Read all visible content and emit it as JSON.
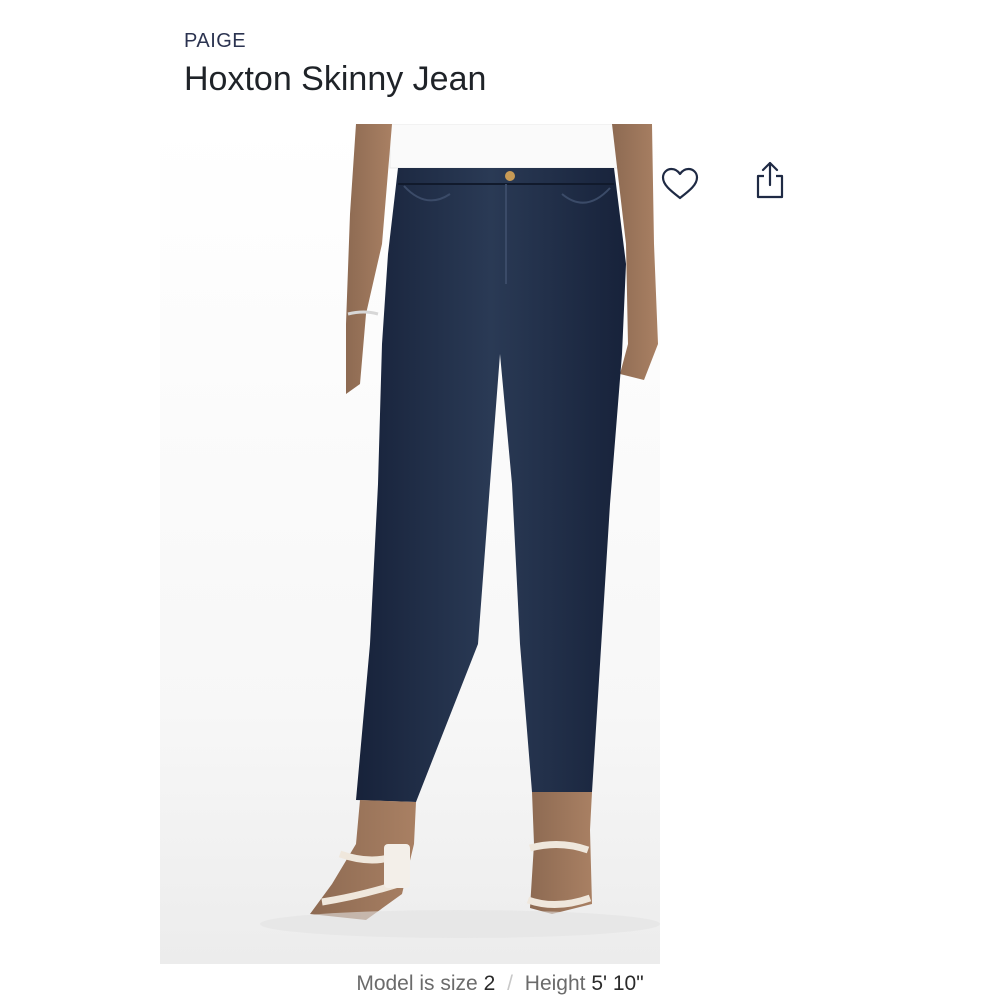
{
  "product": {
    "brand": "PAIGE",
    "title": "Hoxton Skinny Jean"
  },
  "actions": {
    "favorite_icon": "heart-icon",
    "share_icon": "share-icon"
  },
  "model_info": {
    "size_label": "Model is size",
    "size_value": "2",
    "separator": "/",
    "height_label": "Height",
    "height_value": "5' 10\""
  },
  "colors": {
    "brand": "#2b3350",
    "denim": "#1d2a3f",
    "accent_text": "#6b6b6b"
  }
}
